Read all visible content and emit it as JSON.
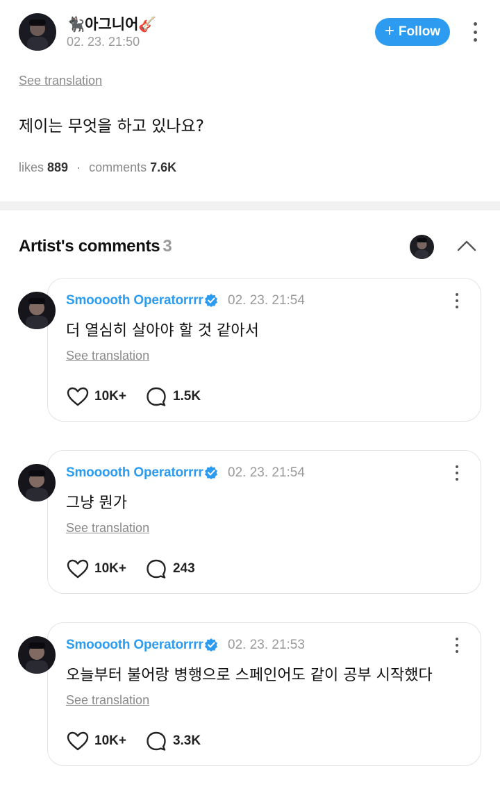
{
  "post": {
    "author": "🐈‍⬛아그니어🎸",
    "date": "02. 23. 21:50",
    "follow_label": "Follow",
    "see_translation": "See translation",
    "text": "제이는 무엇을 하고 있나요?",
    "likes_label": "likes",
    "likes_value": "889",
    "comments_label": "comments",
    "comments_value": "7.6K"
  },
  "artist_comments": {
    "title": "Artist's comments",
    "count": "3"
  },
  "comments": [
    {
      "name": "Smooooth Operatorrrr",
      "date": "02. 23. 21:54",
      "text": "더 열심히 살아야 할 것 같아서",
      "see_translation": "See translation",
      "likes": "10K+",
      "replies": "1.5K"
    },
    {
      "name": "Smooooth Operatorrrr",
      "date": "02. 23. 21:54",
      "text": "그냥 뭔가",
      "see_translation": "See translation",
      "likes": "10K+",
      "replies": "243"
    },
    {
      "name": "Smooooth Operatorrrr",
      "date": "02. 23. 21:53",
      "text": "오늘부터 불어랑 병행으로 스페인어도 같이 공부 시작했다",
      "see_translation": "See translation",
      "likes": "10K+",
      "replies": "3.3K"
    }
  ],
  "icons": {
    "follow": "plus-icon",
    "more": "kebab-icon",
    "collapse": "chevron-up-icon",
    "verified": "verified-badge-icon",
    "like": "heart-icon",
    "reply": "comment-bubble-icon"
  },
  "colors": {
    "accent": "#2d9cf0",
    "muted": "#9a9a9a",
    "divider": "#f1f1f1"
  }
}
